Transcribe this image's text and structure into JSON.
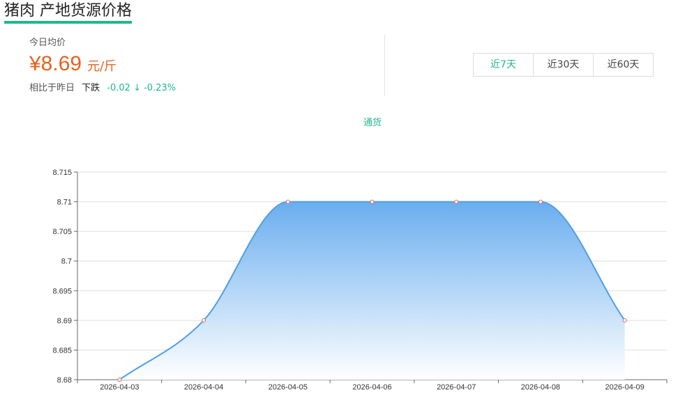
{
  "header": {
    "title": "猪肉 产地货源价格"
  },
  "summary": {
    "avg_label": "今日均价",
    "price": "¥8.69",
    "unit": "元/斤",
    "compare_label": "相比于昨日",
    "direction": "下跌",
    "change": "-0.02 ↓ -0.23%"
  },
  "range_tabs": [
    {
      "label": "近7天",
      "active": true
    },
    {
      "label": "近30天",
      "active": false
    },
    {
      "label": "近60天",
      "active": false
    }
  ],
  "colors": {
    "accent": "#1fb88e",
    "price": "#e8621e",
    "line": "#4f9fe3"
  },
  "chart_data": {
    "type": "area",
    "legend": [
      "通货"
    ],
    "x": [
      "2026-04-03",
      "2026-04-04",
      "2026-04-05",
      "2026-04-06",
      "2026-04-07",
      "2026-04-08",
      "2026-04-09"
    ],
    "series": [
      {
        "name": "通货",
        "values": [
          8.68,
          8.69,
          8.71,
          8.71,
          8.71,
          8.71,
          8.69
        ]
      }
    ],
    "ylim": [
      8.68,
      8.715
    ],
    "yticks": [
      "8.68",
      "8.685",
      "8.69",
      "8.695",
      "8.7",
      "8.705",
      "8.71",
      "8.715"
    ],
    "grid": true,
    "legend_position": "top-center"
  }
}
